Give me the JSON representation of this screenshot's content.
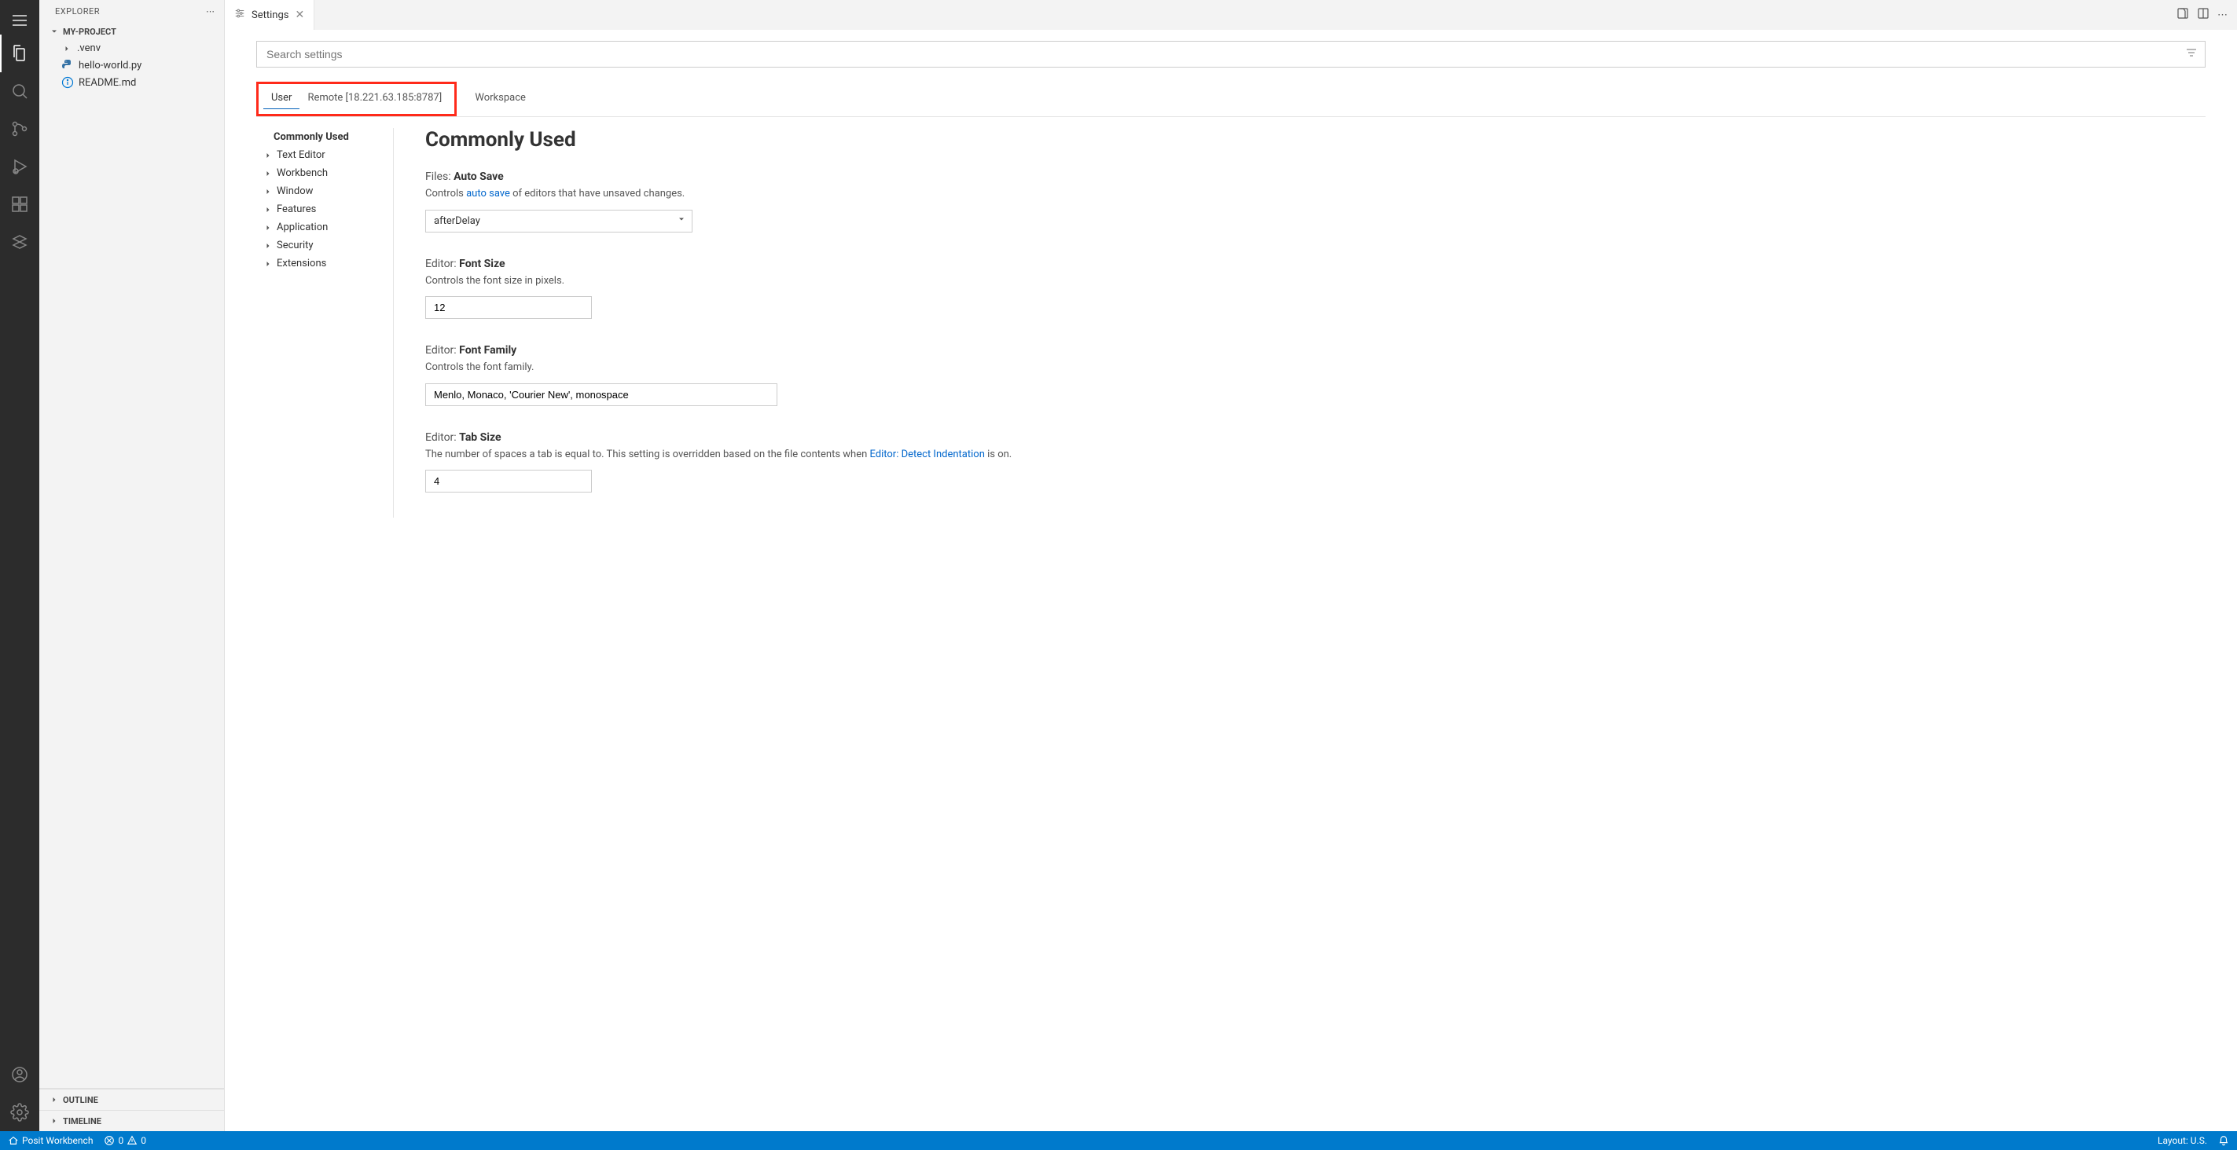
{
  "sidebar": {
    "title": "EXPLORER",
    "project": "MY-PROJECT",
    "files": [
      {
        "name": ".venv",
        "icon": "folder"
      },
      {
        "name": "hello-world.py",
        "icon": "python"
      },
      {
        "name": "README.md",
        "icon": "info"
      }
    ],
    "outline": "OUTLINE",
    "timeline": "TIMELINE"
  },
  "tab": {
    "title": "Settings"
  },
  "search": {
    "placeholder": "Search settings"
  },
  "scope": {
    "user": "User",
    "remote": "Remote [18.221.63.185:8787]",
    "workspace": "Workspace"
  },
  "tree": {
    "commonly_used": "Commonly Used",
    "items": [
      "Text Editor",
      "Workbench",
      "Window",
      "Features",
      "Application",
      "Security",
      "Extensions"
    ]
  },
  "main_heading": "Commonly Used",
  "settings": {
    "auto_save": {
      "cat": "Files: ",
      "name": "Auto Save",
      "desc_pre": "Controls ",
      "desc_link": "auto save",
      "desc_post": " of editors that have unsaved changes.",
      "value": "afterDelay"
    },
    "font_size": {
      "cat": "Editor: ",
      "name": "Font Size",
      "desc": "Controls the font size in pixels.",
      "value": "12"
    },
    "font_family": {
      "cat": "Editor: ",
      "name": "Font Family",
      "desc": "Controls the font family.",
      "value": "Menlo, Monaco, 'Courier New', monospace"
    },
    "tab_size": {
      "cat": "Editor: ",
      "name": "Tab Size",
      "desc_pre": "The number of spaces a tab is equal to. This setting is overridden based on the file contents when ",
      "desc_link": "Editor: Detect Indentation",
      "desc_post": " is on.",
      "value": "4"
    }
  },
  "status": {
    "home": "Posit Workbench",
    "errors": "0",
    "warnings": "0",
    "layout": "Layout: U.S."
  }
}
